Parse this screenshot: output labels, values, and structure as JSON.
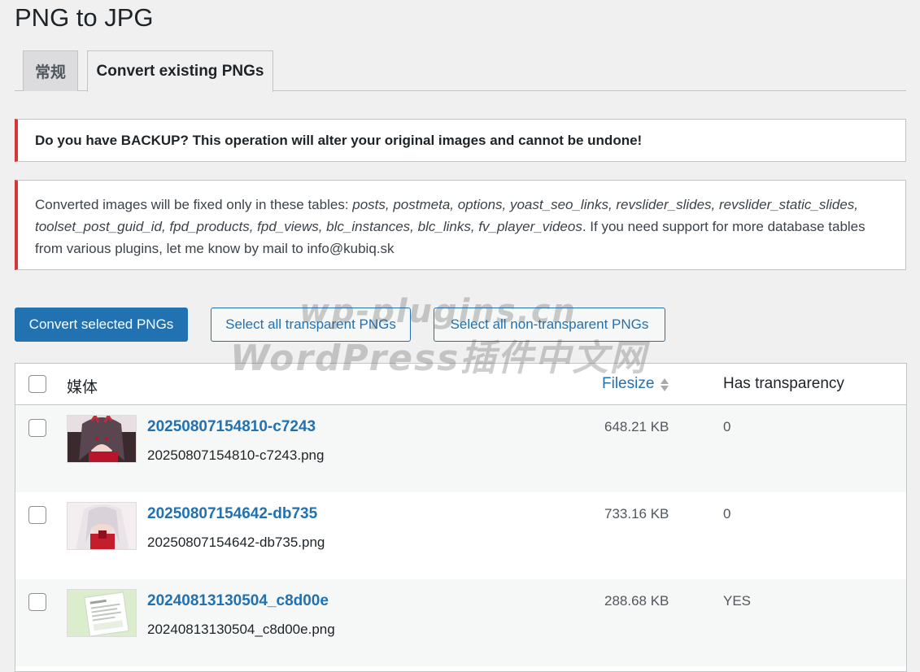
{
  "page": {
    "title": "PNG to JPG"
  },
  "tabs": [
    {
      "label": "常规",
      "active": false
    },
    {
      "label": "Convert existing PNGs",
      "active": true
    }
  ],
  "notices": {
    "backup_warning": "Do you have BACKUP? This operation will alter your original images and cannot be undone!",
    "tables_intro": "Converted images will be fixed only in these tables: ",
    "tables_list": "posts, postmeta, options, yoast_seo_links, revslider_slides, revslider_static_slides, toolset_post_guid_id, fpd_products, fpd_views, blc_instances, blc_links, fv_player_videos",
    "tables_outro": ". If you need support for more database tables from various plugins, let me know by mail to info@kubiq.sk"
  },
  "actions": {
    "convert_selected": "Convert selected PNGs",
    "select_transparent": "Select all transparent PNGs",
    "select_non_transparent": "Select all non-transparent PNGs"
  },
  "watermark": {
    "line1": "wp-plugins.cn",
    "line2": "WordPress插件中文网"
  },
  "table": {
    "columns": {
      "media": "媒体",
      "filesize": "Filesize",
      "transparency": "Has transparency"
    },
    "rows": [
      {
        "title": "20250807154810-c7243",
        "filename": "20250807154810-c7243.png",
        "filesize": "648.21 KB",
        "transparency": "0",
        "thumb": "anime-girl-red-dark"
      },
      {
        "title": "20250807154642-db735",
        "filename": "20250807154642-db735.png",
        "filesize": "733.16 KB",
        "transparency": "0",
        "thumb": "anime-girl-red-white"
      },
      {
        "title": "20240813130504_c8d00e",
        "filename": "20240813130504_c8d00e.png",
        "filesize": "288.68 KB",
        "transparency": "YES",
        "thumb": "document-screenshot-green"
      }
    ]
  },
  "colors": {
    "accent": "#2271b1",
    "error": "#d63638",
    "background": "#f0f0f1"
  }
}
